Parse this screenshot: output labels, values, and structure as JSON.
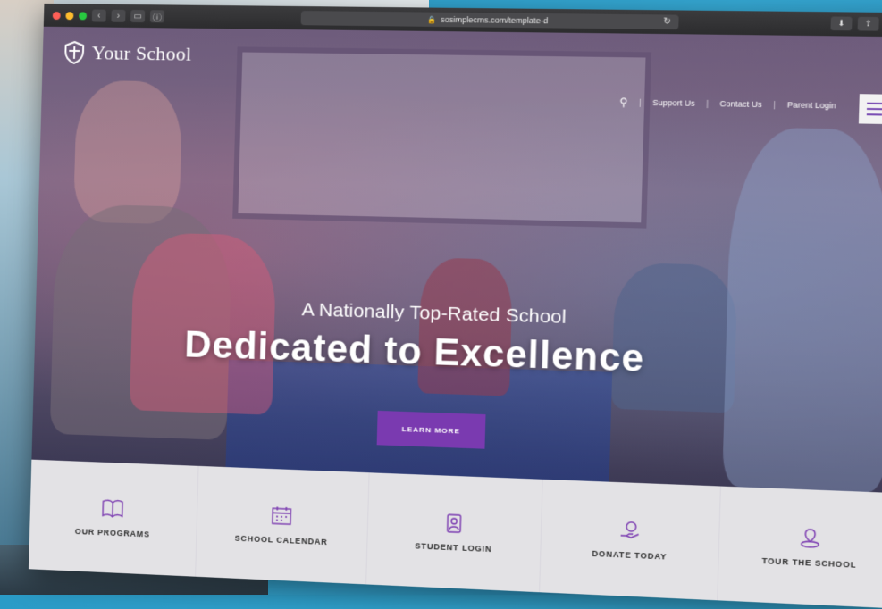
{
  "browser": {
    "url": "sosimplecms.com/template-d"
  },
  "site": {
    "brand": "Your School",
    "nav": {
      "support": "Support Us",
      "contact": "Contact Us",
      "parent_login": "Parent Login"
    },
    "hero": {
      "tagline": "A Nationally Top-Rated School",
      "headline": "Dedicated to Excellence",
      "cta": "LEARN MORE"
    },
    "quick_links": [
      {
        "label": "OUR PROGRAMS",
        "icon": "book-icon"
      },
      {
        "label": "SCHOOL CALENDAR",
        "icon": "calendar-icon"
      },
      {
        "label": "STUDENT LOGIN",
        "icon": "student-icon"
      },
      {
        "label": "DONATE TODAY",
        "icon": "donate-icon"
      },
      {
        "label": "TOUR THE SCHOOL",
        "icon": "tour-icon"
      }
    ]
  },
  "colors": {
    "accent": "#7a3ab0",
    "quicklinks_bg": "#f4f3f6",
    "page_bg": "#2a9bc7"
  }
}
